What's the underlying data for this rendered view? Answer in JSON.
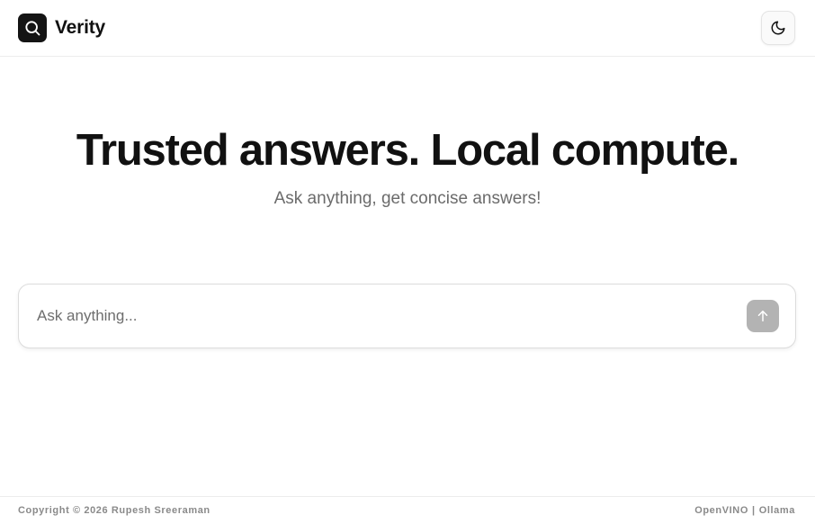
{
  "header": {
    "brand_name": "Verity",
    "logo_icon": "search-icon",
    "theme_toggle_icon": "moon-icon"
  },
  "hero": {
    "title": "Trusted answers. Local compute.",
    "subtitle": "Ask anything, get concise answers!"
  },
  "search": {
    "placeholder": "Ask anything...",
    "value": "",
    "send_icon": "arrow-up-icon"
  },
  "footer": {
    "copyright": "Copyright © 2026 Rupesh Sreeraman",
    "engine_1": "OpenVINO",
    "separator": "|",
    "engine_2": "Ollama"
  },
  "colors": {
    "logo_bg": "#141414",
    "send_button_bg": "#b3b3b3",
    "text_primary": "#111111",
    "text_muted": "#6b6b6b"
  }
}
